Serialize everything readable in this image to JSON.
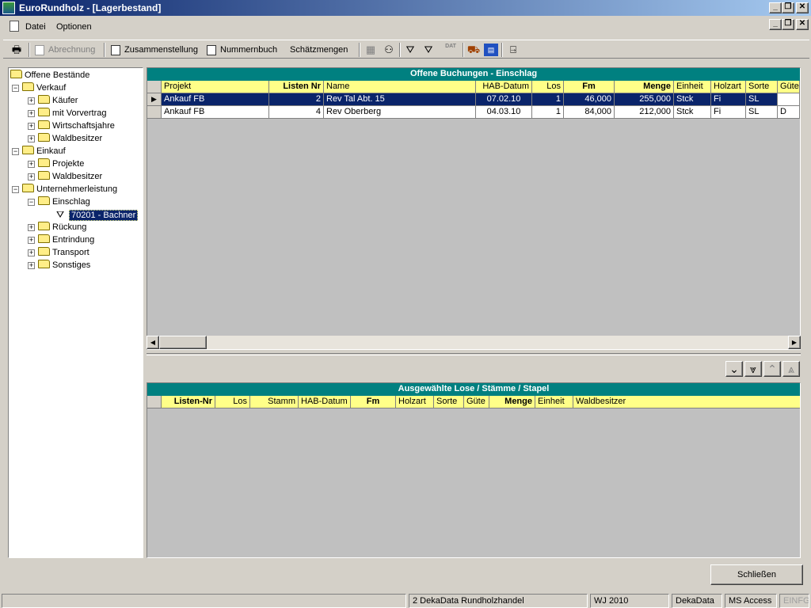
{
  "window": {
    "title": "EuroRundholz - [Lagerbestand]"
  },
  "menu": {
    "datei": "Datei",
    "optionen": "Optionen"
  },
  "toolbar": {
    "abrechnung": "Abrechnung",
    "zusammenstellung": "Zusammenstellung",
    "nummernbuch": "Nummernbuch",
    "schaetzmengen": "Schätzmengen",
    "dat_icon_label": "DAT"
  },
  "tree": {
    "root": "Offene Bestände",
    "verkauf": "Verkauf",
    "kaeufer": "Käufer",
    "mit_vorvertrag": "mit Vorvertrag",
    "wirtschaftsjahre": "Wirtschaftsjahre",
    "waldbesitzer_vk": "Waldbesitzer",
    "einkauf": "Einkauf",
    "projekte": "Projekte",
    "waldbesitzer_ek": "Waldbesitzer",
    "unternehmerleistung": "Unternehmerleistung",
    "einschlag": "Einschlag",
    "filter_70201": "70201 - Bachner",
    "rueckung": "Rückung",
    "entrindung": "Entrindung",
    "transport": "Transport",
    "sonstiges": "Sonstiges"
  },
  "grid_top": {
    "title": "Offene Buchungen - Einschlag",
    "headers": {
      "projekt": "Projekt",
      "listen_nr": "Listen Nr",
      "name": "Name",
      "hab_datum": "HAB-Datum",
      "los": "Los",
      "fm": "Fm",
      "menge": "Menge",
      "einheit": "Einheit",
      "holzart": "Holzart",
      "sorte": "Sorte",
      "guete": "Güte"
    },
    "rows": [
      {
        "projekt": "Ankauf FB",
        "listen_nr": "2",
        "name": "Rev Tal Abt. 15",
        "hab_datum": "07.02.10",
        "los": "1",
        "fm": "46,000",
        "menge": "255,000",
        "einheit": "Stck",
        "holzart": "Fi",
        "sorte": "SL",
        "guete": ""
      },
      {
        "projekt": "Ankauf FB",
        "listen_nr": "4",
        "name": "Rev Oberberg",
        "hab_datum": "04.03.10",
        "los": "1",
        "fm": "84,000",
        "menge": "212,000",
        "einheit": "Stck",
        "holzart": "Fi",
        "sorte": "SL",
        "guete": "D"
      }
    ]
  },
  "grid_bottom": {
    "title": "Ausgewählte Lose / Stämme / Stapel",
    "headers": {
      "listen_nr": "Listen-Nr",
      "los": "Los",
      "stamm": "Stamm",
      "hab_datum": "HAB-Datum",
      "fm": "Fm",
      "holzart": "Holzart",
      "sorte": "Sorte",
      "guete": "Güte",
      "menge": "Menge",
      "einheit": "Einheit",
      "waldbesitzer": "Waldbesitzer"
    }
  },
  "buttons": {
    "schliessen": "Schließen"
  },
  "statusbar": {
    "company": "2 DekaData Rundholzhandel",
    "wj": "WJ 2010",
    "user": "DekaData",
    "db": "MS Access",
    "mode": "EINFG"
  }
}
